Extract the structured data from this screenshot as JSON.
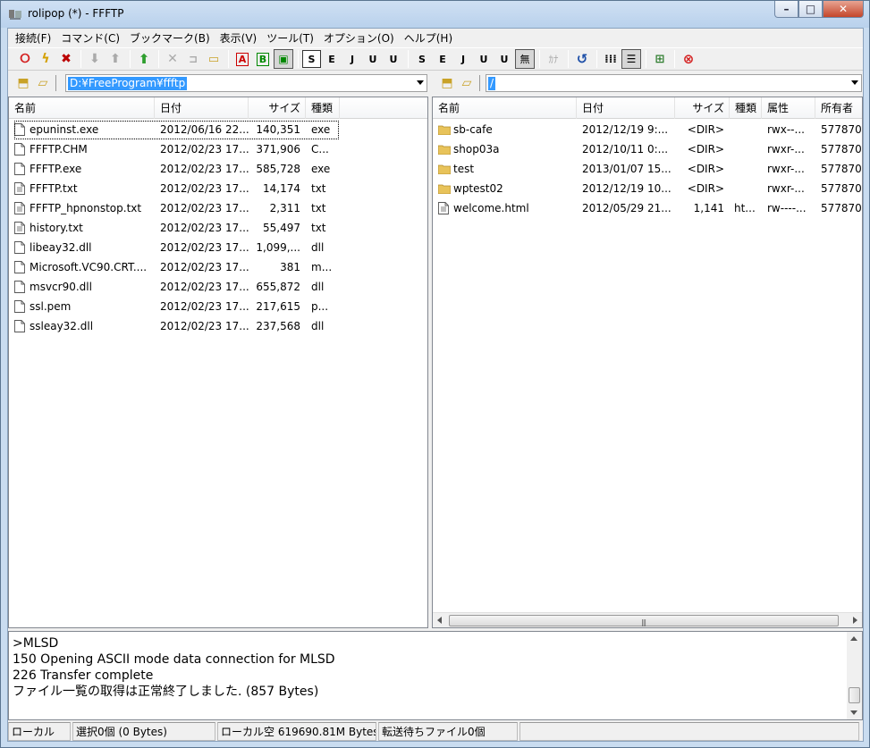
{
  "window": {
    "title": "rolipop (*) - FFFTP"
  },
  "menu": [
    "接続(F)",
    "コマンド(C)",
    "ブックマーク(B)",
    "表示(V)",
    "ツール(T)",
    "オプション(O)",
    "ヘルプ(H)"
  ],
  "toolbar": {
    "kanji_label": "無",
    "kana_label": "ｶﾅ",
    "ascii_label": "A",
    "binary_label": "B",
    "sjis_label": "S",
    "euc_label": "E",
    "jis_label": "J",
    "utf8_label": "U",
    "utf8n_label": "U"
  },
  "local": {
    "path": "D:¥FreeProgram¥ffftp",
    "columns": [
      "名前",
      "日付",
      "サイズ",
      "種類"
    ],
    "files": [
      {
        "name": "epuninst.exe",
        "date": "2012/06/16 22...",
        "size": "140,351",
        "type": "exe",
        "icon": "file-icon"
      },
      {
        "name": "FFFTP.CHM",
        "date": "2012/02/23 17...",
        "size": "371,906",
        "type": "C...",
        "icon": "file-icon"
      },
      {
        "name": "FFFTP.exe",
        "date": "2012/02/23 17...",
        "size": "585,728",
        "type": "exe",
        "icon": "file-icon"
      },
      {
        "name": "FFFTP.txt",
        "date": "2012/02/23 17...",
        "size": "14,174",
        "type": "txt",
        "icon": "text-file-icon"
      },
      {
        "name": "FFFTP_hpnonstop.txt",
        "date": "2012/02/23 17...",
        "size": "2,311",
        "type": "txt",
        "icon": "text-file-icon"
      },
      {
        "name": "history.txt",
        "date": "2012/02/23 17...",
        "size": "55,497",
        "type": "txt",
        "icon": "text-file-icon"
      },
      {
        "name": "libeay32.dll",
        "date": "2012/02/23 17...",
        "size": "1,099,...",
        "type": "dll",
        "icon": "file-icon"
      },
      {
        "name": "Microsoft.VC90.CRT....",
        "date": "2012/02/23 17...",
        "size": "381",
        "type": "m...",
        "icon": "file-icon"
      },
      {
        "name": "msvcr90.dll",
        "date": "2012/02/23 17...",
        "size": "655,872",
        "type": "dll",
        "icon": "file-icon"
      },
      {
        "name": "ssl.pem",
        "date": "2012/02/23 17...",
        "size": "217,615",
        "type": "p...",
        "icon": "file-icon"
      },
      {
        "name": "ssleay32.dll",
        "date": "2012/02/23 17...",
        "size": "237,568",
        "type": "dll",
        "icon": "file-icon"
      }
    ]
  },
  "remote": {
    "path": "/",
    "columns": [
      "名前",
      "日付",
      "サイズ",
      "種類",
      "属性",
      "所有者"
    ],
    "files": [
      {
        "name": "sb-cafe",
        "date": "2012/12/19  9:...",
        "size": "<DIR>",
        "type": "",
        "attr": "rwx--...",
        "owner": "577870",
        "icon": "folder-icon"
      },
      {
        "name": "shop03a",
        "date": "2012/10/11  0:...",
        "size": "<DIR>",
        "type": "",
        "attr": "rwxr-...",
        "owner": "577870",
        "icon": "folder-icon"
      },
      {
        "name": "test",
        "date": "2013/01/07 15...",
        "size": "<DIR>",
        "type": "",
        "attr": "rwxr-...",
        "owner": "577870",
        "icon": "folder-icon"
      },
      {
        "name": "wptest02",
        "date": "2012/12/19 10...",
        "size": "<DIR>",
        "type": "",
        "attr": "rwxr-...",
        "owner": "577870",
        "icon": "folder-icon"
      },
      {
        "name": "welcome.html",
        "date": "2012/05/29 21...",
        "size": "1,141",
        "type": "ht...",
        "attr": "rw----...",
        "owner": "577870",
        "icon": "text-file-icon"
      }
    ]
  },
  "log": [
    ">MLSD",
    "150 Opening ASCII mode data connection for MLSD",
    "226 Transfer complete",
    "ファイル一覧の取得は正常終了しました. (857 Bytes)"
  ],
  "status": {
    "side": "ローカル",
    "selection": "選択0個 (0 Bytes)",
    "free": "ローカル空 619690.81M Bytes",
    "queue": "転送待ちファイル0個"
  },
  "colors": {
    "selection": "#3399ff",
    "folder": "#e8c35a",
    "connect_red": "#d42020",
    "upload_green": "#2e9e2e"
  }
}
